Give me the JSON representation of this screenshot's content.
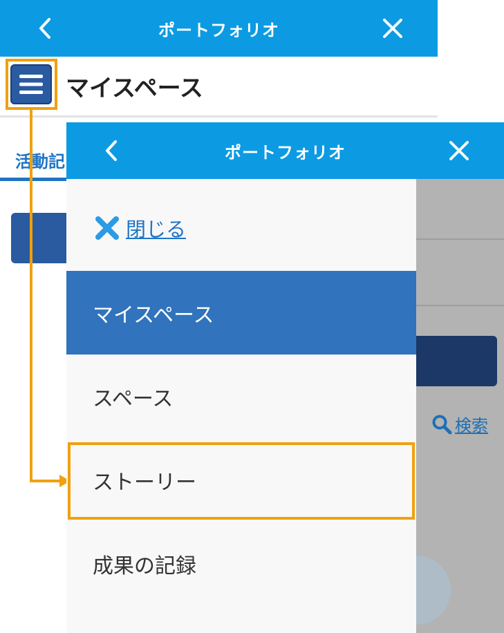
{
  "back_screen": {
    "header": {
      "title": "ポートフォリオ"
    },
    "page_title": "マイスペース",
    "tab_active_label": "活動記"
  },
  "front_screen": {
    "header": {
      "title": "ポートフォリオ"
    },
    "drawer": {
      "close_label": "閉じる",
      "items": [
        {
          "label": "マイスペース",
          "active": true
        },
        {
          "label": "スペース",
          "active": false
        },
        {
          "label": "ストーリー",
          "active": false,
          "highlighted": true
        },
        {
          "label": "成果の記録",
          "active": false
        }
      ]
    },
    "background_search_label": "検索"
  },
  "colors": {
    "header_blue": "#0c9be3",
    "active_item_blue": "#3173bd",
    "highlight_orange": "#f0a10d",
    "link_blue": "#1e74c6"
  },
  "icons": {
    "back": "chevron-left-icon",
    "close": "close-icon",
    "menu": "hamburger-icon",
    "drawer_close": "x-mark-icon",
    "search": "search-icon"
  }
}
